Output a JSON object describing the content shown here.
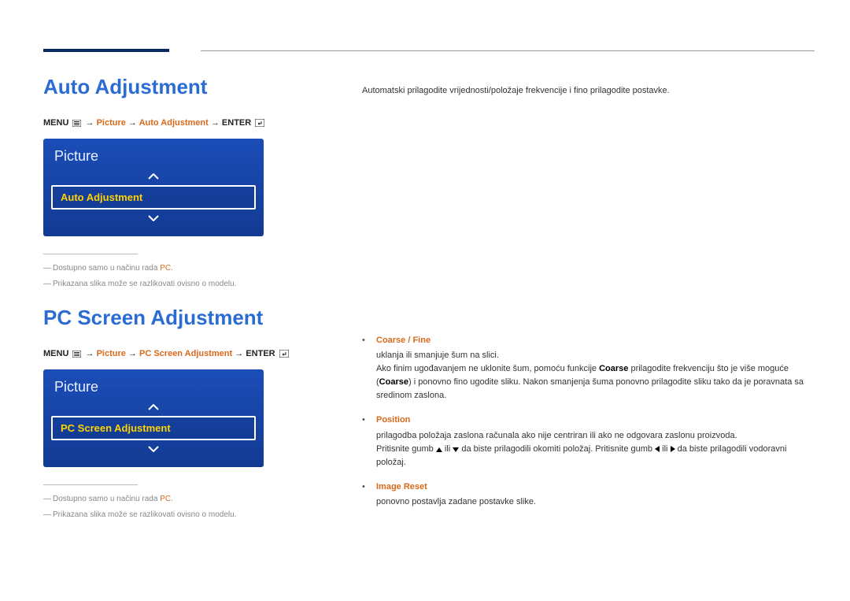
{
  "top": {
    "desc": "Automatski prilagodite vrijednosti/položaje frekvencije i fino prilagodite postavke."
  },
  "section1": {
    "title": "Auto Adjustment",
    "bc_menu": "MENU ",
    "bc_arrow": " → ",
    "bc_picture": "Picture",
    "bc_item": "Auto Adjustment",
    "bc_enter": "ENTER ",
    "panel_title": "Picture",
    "panel_item": "Auto Adjustment",
    "note1_a": "Dostupno samo u načinu rada ",
    "note1_b": "PC",
    "note2": "Prikazana slika može se razlikovati ovisno o modelu."
  },
  "section2": {
    "title": "PC Screen Adjustment",
    "bc_menu": "MENU ",
    "bc_arrow": " → ",
    "bc_picture": "Picture",
    "bc_item": "PC Screen Adjustment",
    "bc_enter": "ENTER ",
    "panel_title": "Picture",
    "panel_item": "PC Screen Adjustment",
    "note1_a": "Dostupno samo u načinu rada ",
    "note1_b": "PC",
    "note2": "Prikazana slika može se razlikovati ovisno o modelu."
  },
  "bullets": {
    "b1_title": "Coarse / Fine",
    "b1_line1": "uklanja ili smanjuje šum na slici.",
    "b1_line2a": "Ako finim ugođavanjem ne uklonite šum, pomoću funkcije ",
    "b1_line2b": "Coarse",
    "b1_line2c": " prilagodite frekvenciju što je više moguće (",
    "b1_line2d": "Coarse",
    "b1_line2e": ") i ponovno fino ugodite sliku. Nakon smanjenja šuma ponovno prilagodite sliku tako da je poravnata sa sredinom zaslona.",
    "b2_title": "Position",
    "b2_line1": "prilagodba položaja zaslona računala ako nije centriran ili ako ne odgovara zaslonu proizvoda.",
    "b2_line2a": "Pritisnite gumb ",
    "b2_line2b": " ili ",
    "b2_line2c": " da biste prilagodili okomiti položaj. Pritisnite gumb ",
    "b2_line2d": " ili ",
    "b2_line2e": " da biste prilagodili vodoravni položaj.",
    "b3_title": "Image Reset",
    "b3_line1": "ponovno postavlja zadane postavke slike."
  }
}
